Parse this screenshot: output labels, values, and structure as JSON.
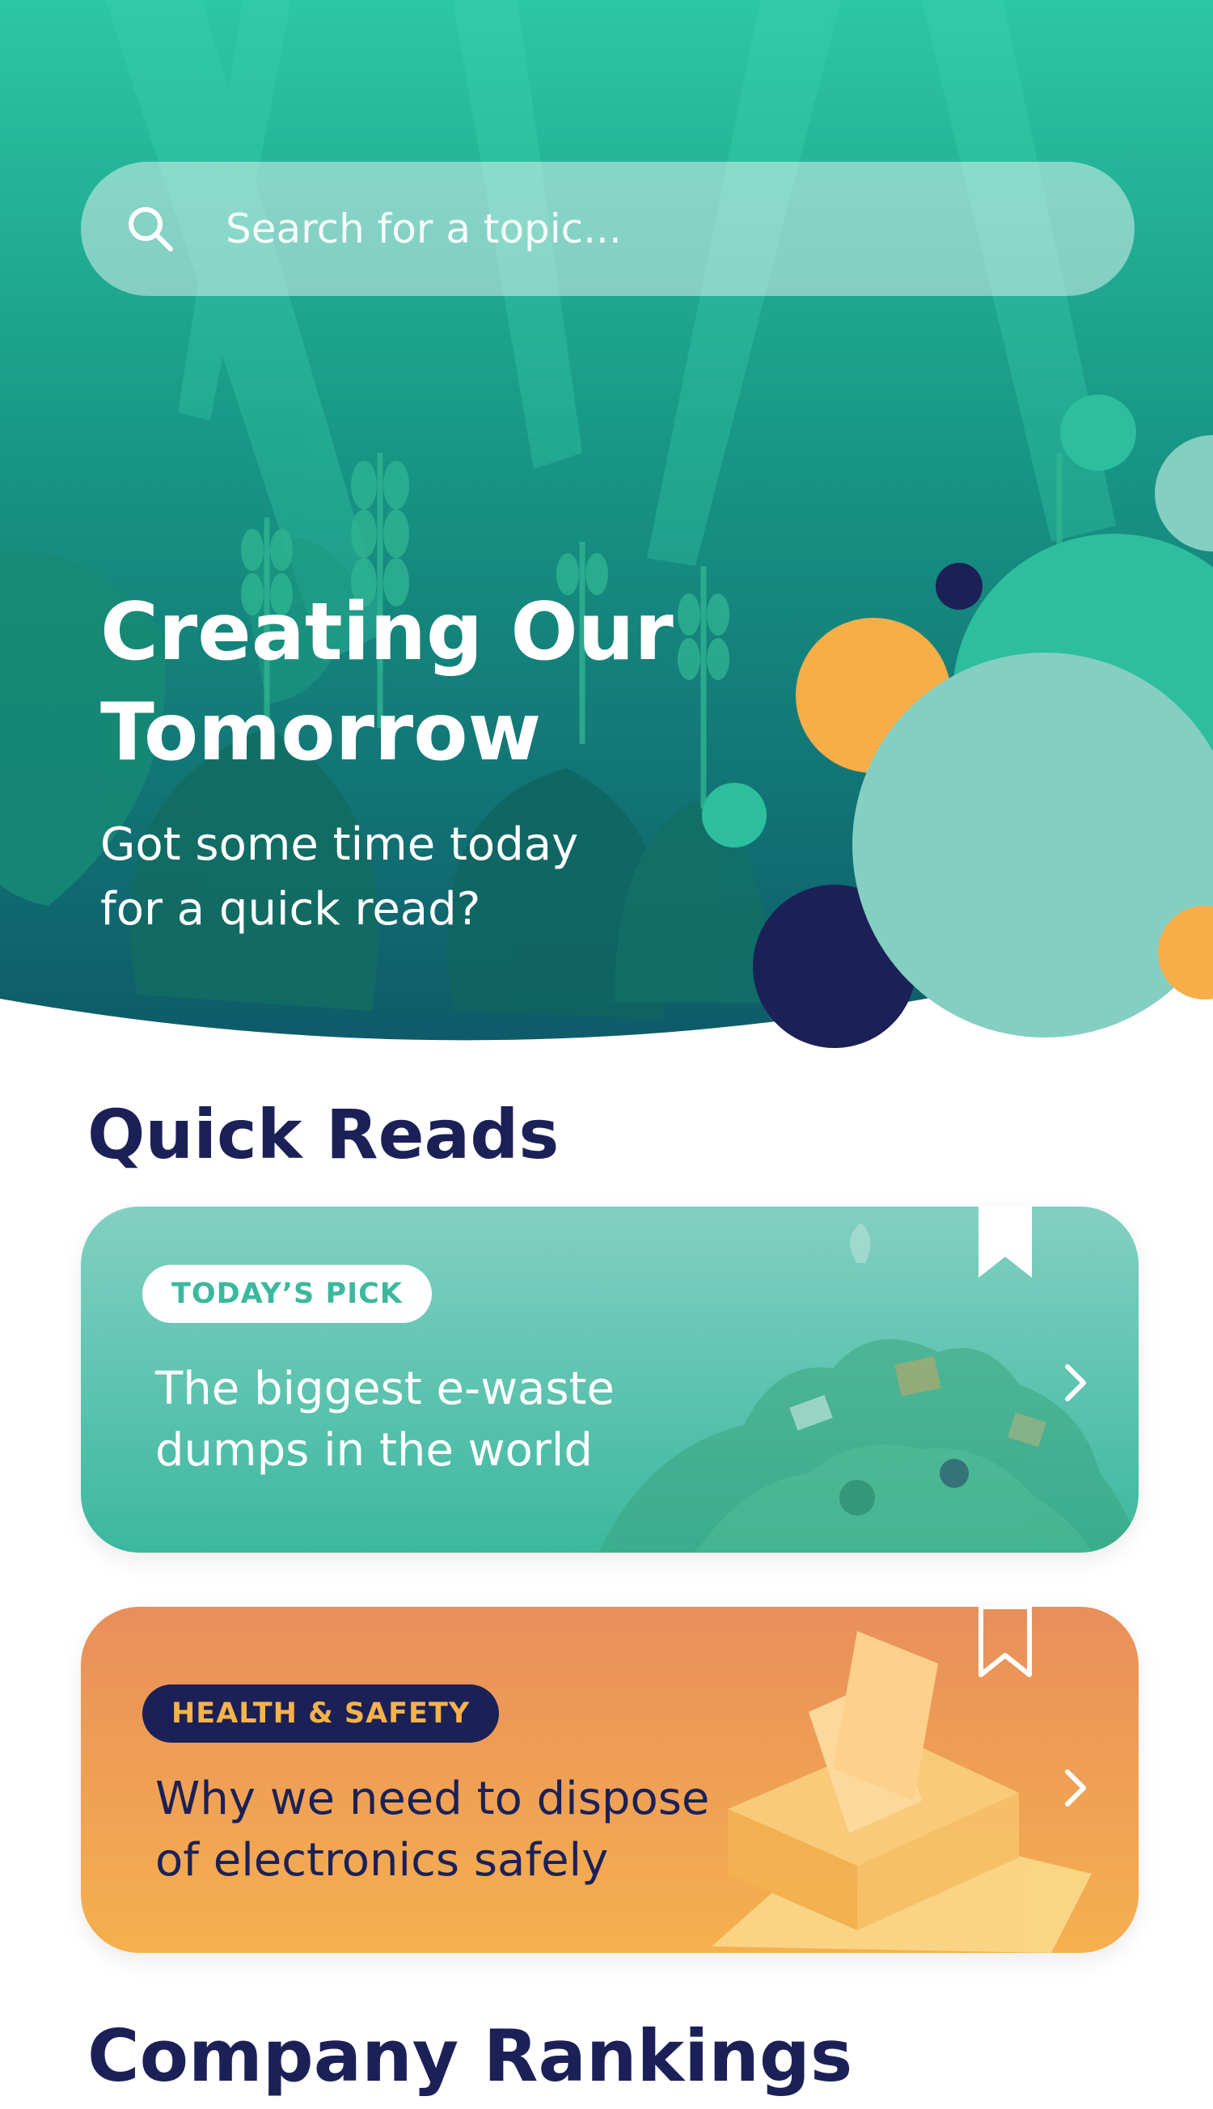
{
  "search": {
    "placeholder": "Search for a topic..."
  },
  "hero": {
    "title": "Creating Our\nTomorrow",
    "subtitle": "Got some time today\nfor a quick read?"
  },
  "quick_reads": {
    "heading": "Quick Reads",
    "cards": [
      {
        "tag": "TODAY’S PICK",
        "title": "The biggest e-waste\ndumps in the world",
        "bookmarked": true
      },
      {
        "tag": "HEALTH & SAFETY",
        "title": "Why we need to dispose\nof electronics safely",
        "bookmarked": false
      }
    ]
  },
  "company_rankings": {
    "heading": "Company Rankings"
  },
  "colors": {
    "navy": "#1b2157",
    "teal": "#3bb89e",
    "mint": "#83d0c2",
    "orange": "#f7ad48",
    "peach": "#e88f5b"
  },
  "icons": {
    "search": "search-icon",
    "bookmark_filled": "bookmark-filled-icon",
    "bookmark_outline": "bookmark-outline-icon",
    "chevron": "chevron-right-icon"
  }
}
